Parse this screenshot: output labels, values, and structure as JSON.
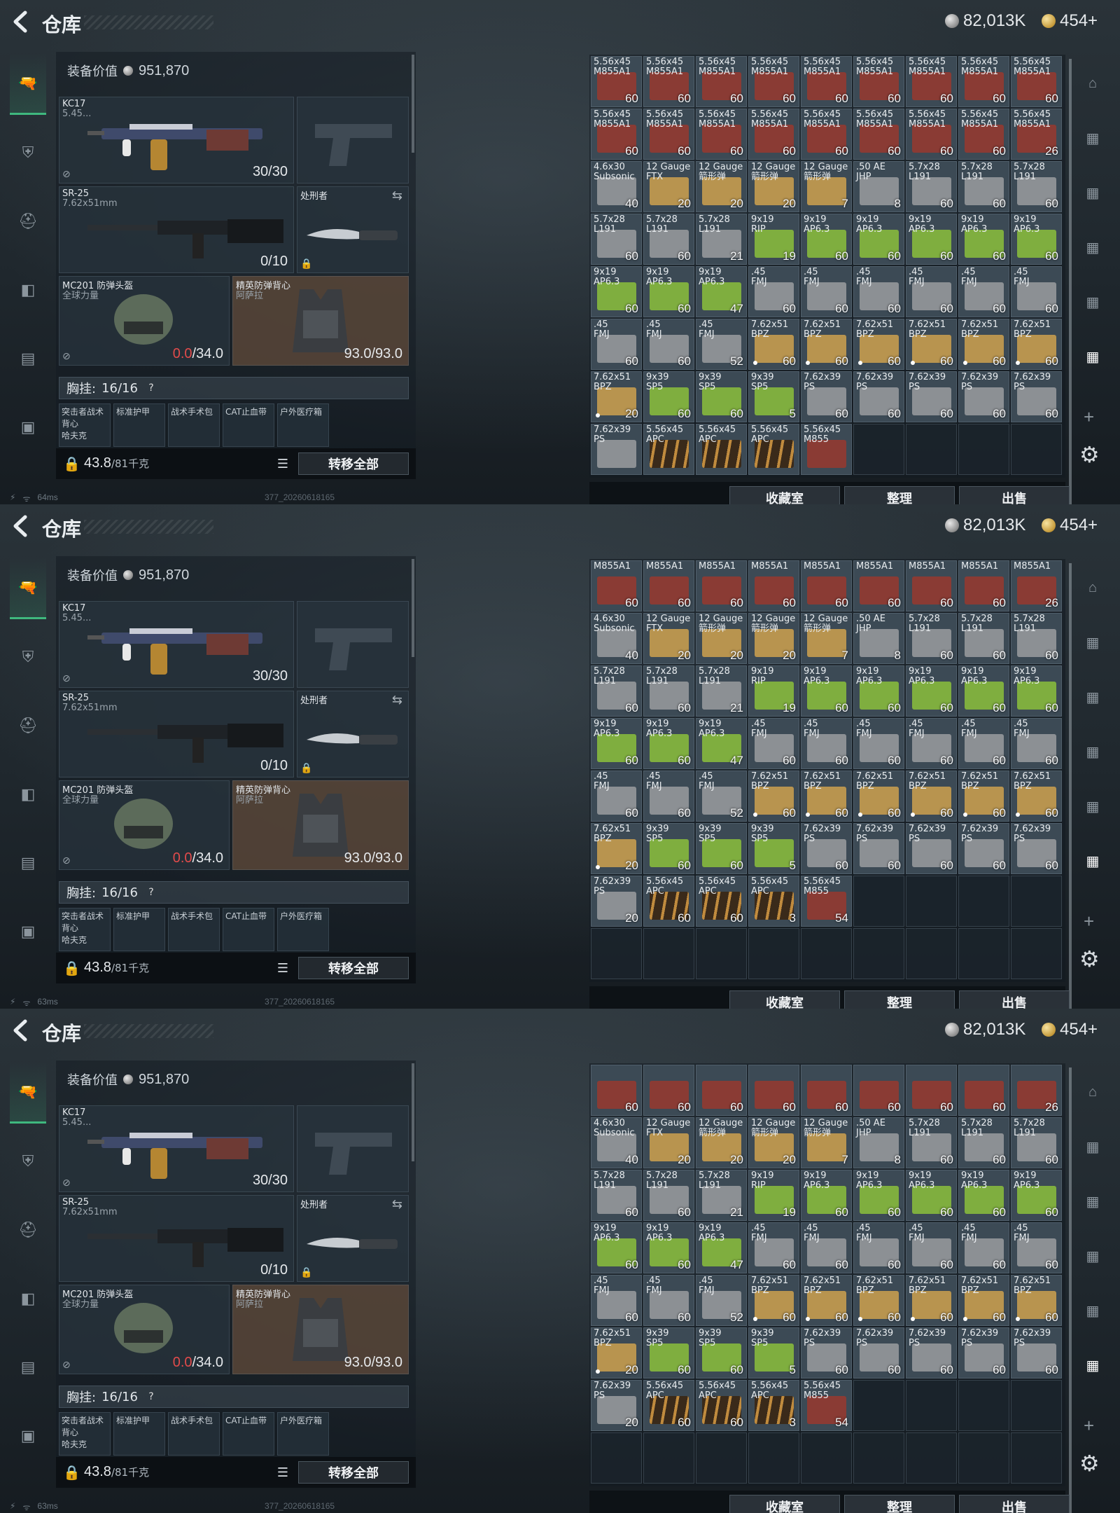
{
  "title": "仓库",
  "currency": {
    "silver": "82,013K",
    "gold": "454+"
  },
  "status": [
    {
      "battery": "⚡",
      "wifi": "ᯤ",
      "ping": "64ms"
    },
    {
      "battery": "⚡",
      "wifi": "ᯤ",
      "ping": "63ms"
    },
    {
      "battery": "⚡",
      "wifi": "ᯤ",
      "ping": "63ms"
    }
  ],
  "build_id": "377_20260618165",
  "loadout": {
    "equip_value_label": "装备价值",
    "equip_value": "951,870",
    "primary": {
      "name": "KC17",
      "caliber": "5.45...",
      "ammo": "30/30"
    },
    "secondary": {
      "name": "SR-25",
      "caliber": "7.62x51mm",
      "ammo": "0/10"
    },
    "melee": {
      "name": "处刑者"
    },
    "helmet": {
      "name": "MC201 防弹头盔",
      "sub": "全球力量",
      "durability_current": "0.0",
      "durability_max": "/34.0"
    },
    "armor": {
      "name": "精英防弹背心",
      "sub": "阿萨拉",
      "durability": "93.0/93.0"
    },
    "chest_label": "胸挂:",
    "chest_value": "16/16",
    "pockets": [
      "突击者战术背心\n哈夫克",
      "标准护甲",
      "战术手术包",
      "CAT止血带",
      "户外医疗箱"
    ],
    "weight": "43.8",
    "weight_unit": "/81千克",
    "transfer_label": "转移全部"
  },
  "buttons": {
    "collection": "收藏室",
    "sort": "整理",
    "sell": "出售"
  },
  "colors": {
    "red": "#8a3b34",
    "tan": "#b8944f",
    "grey": "#8c9094",
    "green": "#7fae3f",
    "bullet": "#6a4a2a"
  },
  "panels": [
    {
      "cells": [
        {
          "n": "5.56x45\nM855A1",
          "c": "60",
          "k": "red"
        },
        {
          "n": "5.56x45\nM855A1",
          "c": "60",
          "k": "red"
        },
        {
          "n": "5.56x45\nM855A1",
          "c": "60",
          "k": "red"
        },
        {
          "n": "5.56x45\nM855A1",
          "c": "60",
          "k": "red"
        },
        {
          "n": "5.56x45\nM855A1",
          "c": "60",
          "k": "red"
        },
        {
          "n": "5.56x45\nM855A1",
          "c": "60",
          "k": "red"
        },
        {
          "n": "5.56x45\nM855A1",
          "c": "60",
          "k": "red"
        },
        {
          "n": "5.56x45\nM855A1",
          "c": "60",
          "k": "red"
        },
        {
          "n": "5.56x45\nM855A1",
          "c": "60",
          "k": "red"
        },
        {
          "n": "5.56x45\nM855A1",
          "c": "60",
          "k": "red"
        },
        {
          "n": "5.56x45\nM855A1",
          "c": "60",
          "k": "red"
        },
        {
          "n": "5.56x45\nM855A1",
          "c": "60",
          "k": "red"
        },
        {
          "n": "5.56x45\nM855A1",
          "c": "60",
          "k": "red"
        },
        {
          "n": "5.56x45\nM855A1",
          "c": "60",
          "k": "red"
        },
        {
          "n": "5.56x45\nM855A1",
          "c": "60",
          "k": "red"
        },
        {
          "n": "5.56x45\nM855A1",
          "c": "60",
          "k": "red"
        },
        {
          "n": "5.56x45\nM855A1",
          "c": "60",
          "k": "red"
        },
        {
          "n": "5.56x45\nM855A1",
          "c": "26",
          "k": "red"
        },
        {
          "n": "4.6x30\nSubsonic",
          "c": "40",
          "k": "grey"
        },
        {
          "n": "12 Gauge\nFTX",
          "c": "20",
          "k": "tan"
        },
        {
          "n": "12 Gauge\n箭形弹",
          "c": "20",
          "k": "tan"
        },
        {
          "n": "12 Gauge\n箭形弹",
          "c": "20",
          "k": "tan"
        },
        {
          "n": "12 Gauge\n箭形弹",
          "c": "7",
          "k": "tan"
        },
        {
          "n": ".50 AE\nJHP",
          "c": "8",
          "k": "grey"
        },
        {
          "n": "5.7x28\nL191",
          "c": "60",
          "k": "grey"
        },
        {
          "n": "5.7x28\nL191",
          "c": "60",
          "k": "grey"
        },
        {
          "n": "5.7x28\nL191",
          "c": "60",
          "k": "grey"
        },
        {
          "n": "5.7x28\nL191",
          "c": "60",
          "k": "grey"
        },
        {
          "n": "5.7x28\nL191",
          "c": "60",
          "k": "grey"
        },
        {
          "n": "5.7x28\nL191",
          "c": "21",
          "k": "grey"
        },
        {
          "n": "9x19\nRIP",
          "c": "19",
          "k": "green"
        },
        {
          "n": "9x19\nAP6.3",
          "c": "60",
          "k": "green"
        },
        {
          "n": "9x19\nAP6.3",
          "c": "60",
          "k": "green"
        },
        {
          "n": "9x19\nAP6.3",
          "c": "60",
          "k": "green"
        },
        {
          "n": "9x19\nAP6.3",
          "c": "60",
          "k": "green"
        },
        {
          "n": "9x19\nAP6.3",
          "c": "60",
          "k": "green"
        },
        {
          "n": "9x19\nAP6.3",
          "c": "60",
          "k": "green"
        },
        {
          "n": "9x19\nAP6.3",
          "c": "60",
          "k": "green"
        },
        {
          "n": "9x19\nAP6.3",
          "c": "47",
          "k": "green"
        },
        {
          "n": ".45\nFMJ",
          "c": "60",
          "k": "grey"
        },
        {
          "n": ".45\nFMJ",
          "c": "60",
          "k": "grey"
        },
        {
          "n": ".45\nFMJ",
          "c": "60",
          "k": "grey"
        },
        {
          "n": ".45\nFMJ",
          "c": "60",
          "k": "grey"
        },
        {
          "n": ".45\nFMJ",
          "c": "60",
          "k": "grey"
        },
        {
          "n": ".45\nFMJ",
          "c": "60",
          "k": "grey"
        },
        {
          "n": ".45\nFMJ",
          "c": "60",
          "k": "grey"
        },
        {
          "n": ".45\nFMJ",
          "c": "60",
          "k": "grey"
        },
        {
          "n": ".45\nFMJ",
          "c": "52",
          "k": "grey"
        },
        {
          "n": "7.62x51\nBPZ",
          "c": "60",
          "k": "tan",
          "d": true
        },
        {
          "n": "7.62x51\nBPZ",
          "c": "60",
          "k": "tan",
          "d": true
        },
        {
          "n": "7.62x51\nBPZ",
          "c": "60",
          "k": "tan",
          "d": true
        },
        {
          "n": "7.62x51\nBPZ",
          "c": "60",
          "k": "tan",
          "d": true
        },
        {
          "n": "7.62x51\nBPZ",
          "c": "60",
          "k": "tan",
          "d": true
        },
        {
          "n": "7.62x51\nBPZ",
          "c": "60",
          "k": "tan",
          "d": true
        },
        {
          "n": "7.62x51\nBPZ",
          "c": "20",
          "k": "tan",
          "d": true
        },
        {
          "n": "9x39\nSP5",
          "c": "60",
          "k": "green"
        },
        {
          "n": "9x39\nSP5",
          "c": "60",
          "k": "green"
        },
        {
          "n": "9x39\nSP5",
          "c": "5",
          "k": "green"
        },
        {
          "n": "7.62x39\nPS",
          "c": "60",
          "k": "grey"
        },
        {
          "n": "7.62x39\nPS",
          "c": "60",
          "k": "grey"
        },
        {
          "n": "7.62x39\nPS",
          "c": "60",
          "k": "grey"
        },
        {
          "n": "7.62x39\nPS",
          "c": "60",
          "k": "grey"
        },
        {
          "n": "7.62x39\nPS",
          "c": "60",
          "k": "grey"
        },
        {
          "n": "7.62x39\nPS",
          "c": "",
          "k": "grey"
        },
        {
          "n": "5.56x45\nAPC",
          "c": "",
          "k": "bullet"
        },
        {
          "n": "5.56x45\nAPC",
          "c": "",
          "k": "bullet"
        },
        {
          "n": "5.56x45\nAPC",
          "c": "",
          "k": "bullet"
        },
        {
          "n": "5.56x45\nM855",
          "c": "",
          "k": "red"
        }
      ]
    },
    {
      "cells": [
        {
          "n": "M855A1",
          "c": "60",
          "k": "red"
        },
        {
          "n": "M855A1",
          "c": "60",
          "k": "red"
        },
        {
          "n": "M855A1",
          "c": "60",
          "k": "red"
        },
        {
          "n": "M855A1",
          "c": "60",
          "k": "red"
        },
        {
          "n": "M855A1",
          "c": "60",
          "k": "red"
        },
        {
          "n": "M855A1",
          "c": "60",
          "k": "red"
        },
        {
          "n": "M855A1",
          "c": "60",
          "k": "red"
        },
        {
          "n": "M855A1",
          "c": "60",
          "k": "red"
        },
        {
          "n": "M855A1",
          "c": "26",
          "k": "red"
        },
        {
          "n": "4.6x30\nSubsonic",
          "c": "40",
          "k": "grey"
        },
        {
          "n": "12 Gauge\nFTX",
          "c": "20",
          "k": "tan"
        },
        {
          "n": "12 Gauge\n箭形弹",
          "c": "20",
          "k": "tan"
        },
        {
          "n": "12 Gauge\n箭形弹",
          "c": "20",
          "k": "tan"
        },
        {
          "n": "12 Gauge\n箭形弹",
          "c": "7",
          "k": "tan"
        },
        {
          "n": ".50 AE\nJHP",
          "c": "8",
          "k": "grey"
        },
        {
          "n": "5.7x28\nL191",
          "c": "60",
          "k": "grey"
        },
        {
          "n": "5.7x28\nL191",
          "c": "60",
          "k": "grey"
        },
        {
          "n": "5.7x28\nL191",
          "c": "60",
          "k": "grey"
        },
        {
          "n": "5.7x28\nL191",
          "c": "60",
          "k": "grey"
        },
        {
          "n": "5.7x28\nL191",
          "c": "60",
          "k": "grey"
        },
        {
          "n": "5.7x28\nL191",
          "c": "21",
          "k": "grey"
        },
        {
          "n": "9x19\nRIP",
          "c": "19",
          "k": "green"
        },
        {
          "n": "9x19\nAP6.3",
          "c": "60",
          "k": "green"
        },
        {
          "n": "9x19\nAP6.3",
          "c": "60",
          "k": "green"
        },
        {
          "n": "9x19\nAP6.3",
          "c": "60",
          "k": "green"
        },
        {
          "n": "9x19\nAP6.3",
          "c": "60",
          "k": "green"
        },
        {
          "n": "9x19\nAP6.3",
          "c": "60",
          "k": "green"
        },
        {
          "n": "9x19\nAP6.3",
          "c": "60",
          "k": "green"
        },
        {
          "n": "9x19\nAP6.3",
          "c": "60",
          "k": "green"
        },
        {
          "n": "9x19\nAP6.3",
          "c": "47",
          "k": "green"
        },
        {
          "n": ".45\nFMJ",
          "c": "60",
          "k": "grey"
        },
        {
          "n": ".45\nFMJ",
          "c": "60",
          "k": "grey"
        },
        {
          "n": ".45\nFMJ",
          "c": "60",
          "k": "grey"
        },
        {
          "n": ".45\nFMJ",
          "c": "60",
          "k": "grey"
        },
        {
          "n": ".45\nFMJ",
          "c": "60",
          "k": "grey"
        },
        {
          "n": ".45\nFMJ",
          "c": "60",
          "k": "grey"
        },
        {
          "n": ".45\nFMJ",
          "c": "60",
          "k": "grey"
        },
        {
          "n": ".45\nFMJ",
          "c": "60",
          "k": "grey"
        },
        {
          "n": ".45\nFMJ",
          "c": "52",
          "k": "grey"
        },
        {
          "n": "7.62x51\nBPZ",
          "c": "60",
          "k": "tan",
          "d": true
        },
        {
          "n": "7.62x51\nBPZ",
          "c": "60",
          "k": "tan",
          "d": true
        },
        {
          "n": "7.62x51\nBPZ",
          "c": "60",
          "k": "tan",
          "d": true
        },
        {
          "n": "7.62x51\nBPZ",
          "c": "60",
          "k": "tan",
          "d": true
        },
        {
          "n": "7.62x51\nBPZ",
          "c": "60",
          "k": "tan",
          "d": true
        },
        {
          "n": "7.62x51\nBPZ",
          "c": "60",
          "k": "tan",
          "d": true
        },
        {
          "n": "7.62x51\nBPZ",
          "c": "20",
          "k": "tan",
          "d": true
        },
        {
          "n": "9x39\nSP5",
          "c": "60",
          "k": "green"
        },
        {
          "n": "9x39\nSP5",
          "c": "60",
          "k": "green"
        },
        {
          "n": "9x39\nSP5",
          "c": "5",
          "k": "green"
        },
        {
          "n": "7.62x39\nPS",
          "c": "60",
          "k": "grey"
        },
        {
          "n": "7.62x39\nPS",
          "c": "60",
          "k": "grey"
        },
        {
          "n": "7.62x39\nPS",
          "c": "60",
          "k": "grey"
        },
        {
          "n": "7.62x39\nPS",
          "c": "60",
          "k": "grey"
        },
        {
          "n": "7.62x39\nPS",
          "c": "60",
          "k": "grey"
        },
        {
          "n": "7.62x39\nPS",
          "c": "20",
          "k": "grey"
        },
        {
          "n": "5.56x45\nAPC",
          "c": "60",
          "k": "bullet"
        },
        {
          "n": "5.56x45\nAPC",
          "c": "60",
          "k": "bullet"
        },
        {
          "n": "5.56x45\nAPC",
          "c": "3",
          "k": "bullet"
        },
        {
          "n": "5.56x45\nM855",
          "c": "54",
          "k": "red"
        }
      ]
    },
    {
      "cells": [
        {
          "n": "",
          "c": "60",
          "k": "red"
        },
        {
          "n": "",
          "c": "60",
          "k": "red"
        },
        {
          "n": "",
          "c": "60",
          "k": "red"
        },
        {
          "n": "",
          "c": "60",
          "k": "red"
        },
        {
          "n": "",
          "c": "60",
          "k": "red"
        },
        {
          "n": "",
          "c": "60",
          "k": "red"
        },
        {
          "n": "",
          "c": "60",
          "k": "red"
        },
        {
          "n": "",
          "c": "60",
          "k": "red"
        },
        {
          "n": "",
          "c": "26",
          "k": "red"
        },
        {
          "n": "4.6x30\nSubsonic",
          "c": "40",
          "k": "grey"
        },
        {
          "n": "12 Gauge\nFTX",
          "c": "20",
          "k": "tan"
        },
        {
          "n": "12 Gauge\n箭形弹",
          "c": "20",
          "k": "tan"
        },
        {
          "n": "12 Gauge\n箭形弹",
          "c": "20",
          "k": "tan"
        },
        {
          "n": "12 Gauge\n箭形弹",
          "c": "7",
          "k": "tan"
        },
        {
          "n": ".50 AE\nJHP",
          "c": "8",
          "k": "grey"
        },
        {
          "n": "5.7x28\nL191",
          "c": "60",
          "k": "grey"
        },
        {
          "n": "5.7x28\nL191",
          "c": "60",
          "k": "grey"
        },
        {
          "n": "5.7x28\nL191",
          "c": "60",
          "k": "grey"
        },
        {
          "n": "5.7x28\nL191",
          "c": "60",
          "k": "grey"
        },
        {
          "n": "5.7x28\nL191",
          "c": "60",
          "k": "grey"
        },
        {
          "n": "5.7x28\nL191",
          "c": "21",
          "k": "grey"
        },
        {
          "n": "9x19\nRIP",
          "c": "19",
          "k": "green"
        },
        {
          "n": "9x19\nAP6.3",
          "c": "60",
          "k": "green"
        },
        {
          "n": "9x19\nAP6.3",
          "c": "60",
          "k": "green"
        },
        {
          "n": "9x19\nAP6.3",
          "c": "60",
          "k": "green"
        },
        {
          "n": "9x19\nAP6.3",
          "c": "60",
          "k": "green"
        },
        {
          "n": "9x19\nAP6.3",
          "c": "60",
          "k": "green"
        },
        {
          "n": "9x19\nAP6.3",
          "c": "60",
          "k": "green"
        },
        {
          "n": "9x19\nAP6.3",
          "c": "60",
          "k": "green"
        },
        {
          "n": "9x19\nAP6.3",
          "c": "47",
          "k": "green"
        },
        {
          "n": ".45\nFMJ",
          "c": "60",
          "k": "grey"
        },
        {
          "n": ".45\nFMJ",
          "c": "60",
          "k": "grey"
        },
        {
          "n": ".45\nFMJ",
          "c": "60",
          "k": "grey"
        },
        {
          "n": ".45\nFMJ",
          "c": "60",
          "k": "grey"
        },
        {
          "n": ".45\nFMJ",
          "c": "60",
          "k": "grey"
        },
        {
          "n": ".45\nFMJ",
          "c": "60",
          "k": "grey"
        },
        {
          "n": ".45\nFMJ",
          "c": "60",
          "k": "grey"
        },
        {
          "n": ".45\nFMJ",
          "c": "60",
          "k": "grey"
        },
        {
          "n": ".45\nFMJ",
          "c": "52",
          "k": "grey"
        },
        {
          "n": "7.62x51\nBPZ",
          "c": "60",
          "k": "tan",
          "d": true
        },
        {
          "n": "7.62x51\nBPZ",
          "c": "60",
          "k": "tan",
          "d": true
        },
        {
          "n": "7.62x51\nBPZ",
          "c": "60",
          "k": "tan",
          "d": true
        },
        {
          "n": "7.62x51\nBPZ",
          "c": "60",
          "k": "tan",
          "d": true
        },
        {
          "n": "7.62x51\nBPZ",
          "c": "60",
          "k": "tan",
          "d": true
        },
        {
          "n": "7.62x51\nBPZ",
          "c": "60",
          "k": "tan",
          "d": true
        },
        {
          "n": "7.62x51\nBPZ",
          "c": "20",
          "k": "tan",
          "d": true
        },
        {
          "n": "9x39\nSP5",
          "c": "60",
          "k": "green"
        },
        {
          "n": "9x39\nSP5",
          "c": "60",
          "k": "green"
        },
        {
          "n": "9x39\nSP5",
          "c": "5",
          "k": "green"
        },
        {
          "n": "7.62x39\nPS",
          "c": "60",
          "k": "grey"
        },
        {
          "n": "7.62x39\nPS",
          "c": "60",
          "k": "grey"
        },
        {
          "n": "7.62x39\nPS",
          "c": "60",
          "k": "grey"
        },
        {
          "n": "7.62x39\nPS",
          "c": "60",
          "k": "grey"
        },
        {
          "n": "7.62x39\nPS",
          "c": "60",
          "k": "grey"
        },
        {
          "n": "7.62x39\nPS",
          "c": "20",
          "k": "grey"
        },
        {
          "n": "5.56x45\nAPC",
          "c": "60",
          "k": "bullet"
        },
        {
          "n": "5.56x45\nAPC",
          "c": "60",
          "k": "bullet"
        },
        {
          "n": "5.56x45\nAPC",
          "c": "3",
          "k": "bullet"
        },
        {
          "n": "5.56x45\nM855",
          "c": "54",
          "k": "red"
        }
      ]
    }
  ]
}
